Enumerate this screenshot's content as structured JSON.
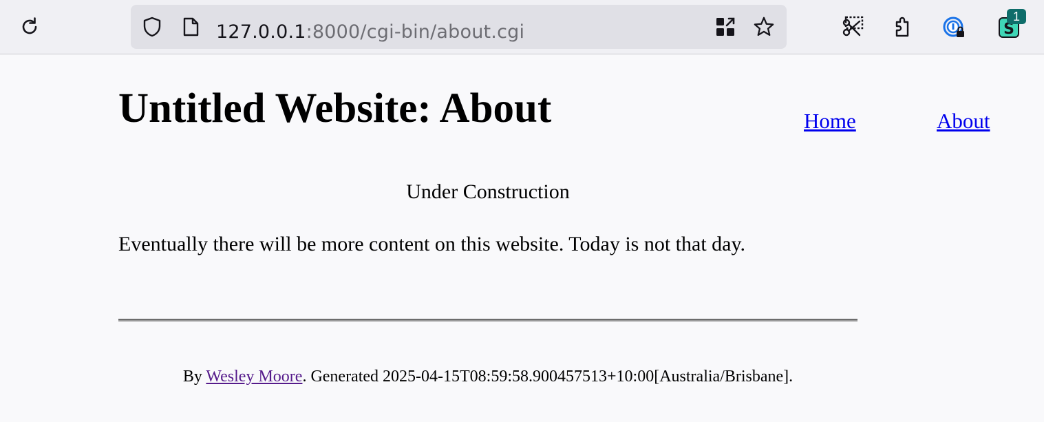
{
  "browser": {
    "url_host": "127.0.0.1",
    "url_rest": ":8000/cgi-bin/about.cgi",
    "extension_badge": "1",
    "icons": [
      "reload-icon",
      "shield-icon",
      "page-icon",
      "qr-code-icon",
      "star-icon",
      "screenshot-icon",
      "extensions-icon",
      "password-manager-icon",
      "extension-s-icon"
    ],
    "colors": {
      "toolbar_bg": "#f0f0f4",
      "urlbar_bg": "#e0e0e6",
      "badge_bg": "#0e6d6a"
    }
  },
  "page": {
    "title": "Untitled Website: About",
    "nav": {
      "home": "Home",
      "about": "About"
    },
    "notice": "Under Construction",
    "body": "Eventually there will be more content on this website. Today is not that day.",
    "footer": {
      "prefix": "By ",
      "author": "Wesley Moore",
      "generated": ". Generated 2025-04-15T08:59:58.900457513+10:00[Australia/Brisbane]."
    },
    "colors": {
      "link": "#0000ee",
      "visited_link": "#551a8b",
      "background": "#f9f9fb"
    }
  }
}
